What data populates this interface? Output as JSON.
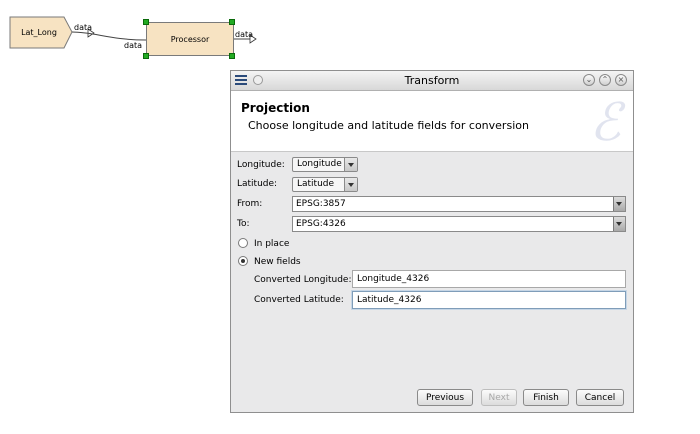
{
  "canvas": {
    "source_node": "Lat_Long",
    "processor_node": "Processor",
    "port_out_label": "data",
    "port_in_label": "data",
    "processor_out_label": "data"
  },
  "dialog": {
    "title": "Transform",
    "banner": {
      "title": "Projection",
      "subtitle": "Choose longitude and latitude fields for conversion"
    },
    "fields": {
      "longitude": {
        "label": "Longitude:",
        "value": "Longitude"
      },
      "latitude": {
        "label": "Latitude:",
        "value": "Latitude"
      },
      "from": {
        "label": "From:",
        "value": "EPSG:3857"
      },
      "to": {
        "label": "To:",
        "value": "EPSG:4326"
      }
    },
    "mode": {
      "in_place_label": "In place",
      "new_fields_label": "New fields",
      "selected": "New fields"
    },
    "converted": {
      "longitude_label": "Converted Longitude:",
      "longitude_value": "Longitude_4326",
      "latitude_label": "Converted Latitude:",
      "latitude_value": "Latitude_4326"
    },
    "buttons": {
      "previous": "Previous",
      "next": "Next",
      "finish": "Finish",
      "cancel": "Cancel"
    }
  },
  "colors": {
    "node_fill": "#f7e3c2",
    "handle": "#22aa22",
    "dialog_bg": "#e9e9ea"
  }
}
